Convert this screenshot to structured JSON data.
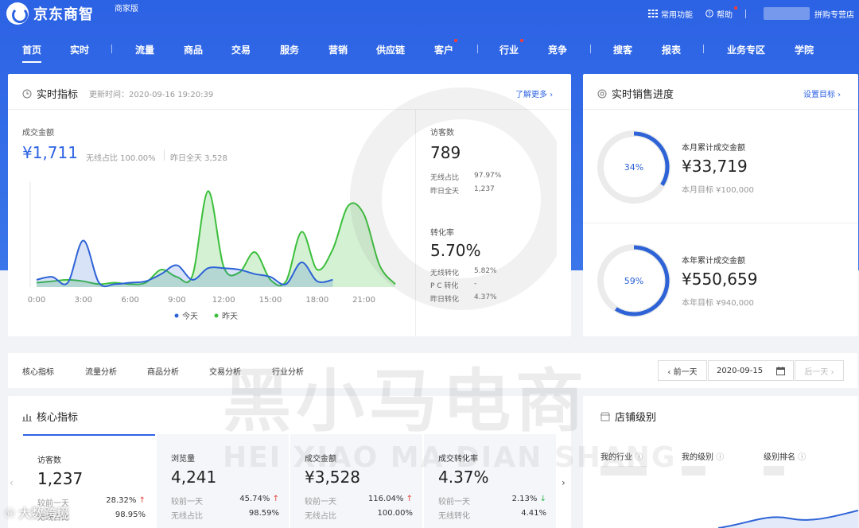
{
  "header": {
    "brand": "京东商智",
    "edition": "商家版",
    "common_functions": "常用功能",
    "help": "帮助",
    "shop_name": "拼购专营店"
  },
  "nav": {
    "items": [
      "首页",
      "实时",
      "流量",
      "商品",
      "交易",
      "服务",
      "营销",
      "供应链",
      "客户",
      "行业",
      "竞争",
      "搜客",
      "报表",
      "业务专区",
      "学院"
    ]
  },
  "realtime": {
    "title": "实时指标",
    "updated": "更新时间：2020-09-16 19:20:39",
    "more": "了解更多 ›",
    "gmv_label": "成交金额",
    "gmv_value": "¥1,711",
    "wireless_share": "无线占比 100.00%",
    "yesterday_total": "昨日全天 3,528",
    "legend_today": "今天",
    "legend_yesterday": "昨天",
    "visitors_label": "访客数",
    "visitors_value": "789",
    "visitors_wireless_label": "无线占比",
    "visitors_wireless_value": "97.97%",
    "visitors_yesterday_label": "昨日全天",
    "visitors_yesterday_value": "1,237",
    "conv_label": "转化率",
    "conv_value": "5.70%",
    "conv_wireless_label": "无线转化",
    "conv_wireless_value": "5.82%",
    "conv_pc_label": "P C 转化",
    "conv_pc_value": "-",
    "conv_yesterday_label": "昨日转化",
    "conv_yesterday_value": "4.37%"
  },
  "chart_data": {
    "type": "area",
    "x": [
      "0:00",
      "1:00",
      "2:00",
      "3:00",
      "4:00",
      "5:00",
      "6:00",
      "7:00",
      "8:00",
      "9:00",
      "10:00",
      "11:00",
      "12:00",
      "13:00",
      "14:00",
      "15:00",
      "16:00",
      "17:00",
      "18:00",
      "19:00",
      "20:00",
      "21:00",
      "22:00",
      "23:00"
    ],
    "xticks": [
      "0:00",
      "3:00",
      "6:00",
      "9:00",
      "12:00",
      "15:00",
      "18:00",
      "21:00"
    ],
    "series": [
      {
        "name": "今天",
        "color": "#2d63d6",
        "values": [
          5,
          7,
          3,
          32,
          3,
          2,
          3,
          4,
          9,
          15,
          5,
          13,
          13,
          12,
          9,
          7,
          2,
          17,
          4,
          5
        ]
      },
      {
        "name": "昨天",
        "color": "#3cbf3c",
        "values": [
          3,
          4,
          5,
          4,
          2,
          3,
          2,
          3,
          12,
          7,
          8,
          66,
          14,
          10,
          24,
          5,
          4,
          38,
          12,
          26,
          56,
          50,
          15,
          2
        ]
      }
    ],
    "ylim": [
      0,
      70
    ],
    "grid": false,
    "legend": "bottom"
  },
  "sales_progress": {
    "title": "实时销售进度",
    "set_target": "设置目标 ›",
    "month": {
      "percent_text": "34%",
      "percent": 34,
      "label": "本月累计成交金额",
      "value": "¥33,719",
      "target": "本月目标 ¥100,000"
    },
    "year": {
      "percent_text": "59%",
      "percent": 59,
      "label": "本年累计成交金额",
      "value": "¥550,659",
      "target": "本年目标 ¥940,000"
    }
  },
  "analysis_tabs": [
    "核心指标",
    "流量分析",
    "商品分析",
    "交易分析",
    "行业分析"
  ],
  "date_picker": {
    "prev": "‹ 前一天",
    "date": "2020-09-15",
    "next": "后一天 ›"
  },
  "core": {
    "title": "核心指标",
    "metrics": [
      {
        "label": "访客数",
        "value": "1,237",
        "r1_label": "较前一天",
        "r1_value": "28.32%",
        "r1_dir": "↑",
        "r2_label": "无线占比",
        "r2_value": "98.95%"
      },
      {
        "label": "浏览量",
        "value": "4,241",
        "r1_label": "较前一天",
        "r1_value": "45.74%",
        "r1_dir": "↑",
        "r2_label": "无线占比",
        "r2_value": "98.59%"
      },
      {
        "label": "成交金额",
        "value": "¥3,528",
        "r1_label": "较前一天",
        "r1_value": "116.04%",
        "r1_dir": "↑",
        "r2_label": "无线占比",
        "r2_value": "100.00%"
      },
      {
        "label": "成交转化率",
        "value": "4.37%",
        "r1_label": "较前一天",
        "r1_value": "2.13%",
        "r1_dir": "↓",
        "r2_label": "无线转化",
        "r2_value": "4.41%"
      }
    ]
  },
  "shop_level": {
    "title": "店铺级别",
    "industry": "我的行业",
    "level": "我的级别",
    "rank": "级别排名"
  },
  "watermark": {
    "cn": "黑小马电商",
    "en": "HEI XIAO MA DIAN SHANG",
    "corner": "大数跨境"
  }
}
